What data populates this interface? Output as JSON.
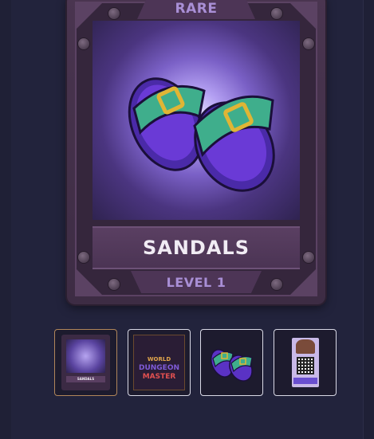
{
  "card": {
    "rarity": "RARE",
    "name": "SANDALS",
    "level": "LEVEL 1",
    "rarity_color": "#a98fd6"
  },
  "thumbnails": [
    {
      "id": "card-front",
      "label": "SANDALS",
      "selected": true
    },
    {
      "id": "game-poster",
      "label_line1": "WORLD",
      "label_line2": "DUNGEON",
      "label_line3": "MASTER",
      "selected": false
    },
    {
      "id": "sandals-art",
      "selected": false
    },
    {
      "id": "qr-poster",
      "selected": false
    }
  ],
  "colors": {
    "background": "#1f2036",
    "panel": "#22233c",
    "card_frame": "#4a3550",
    "selected_border": "#b0865a",
    "thumb_border": "#d9d9e6"
  }
}
